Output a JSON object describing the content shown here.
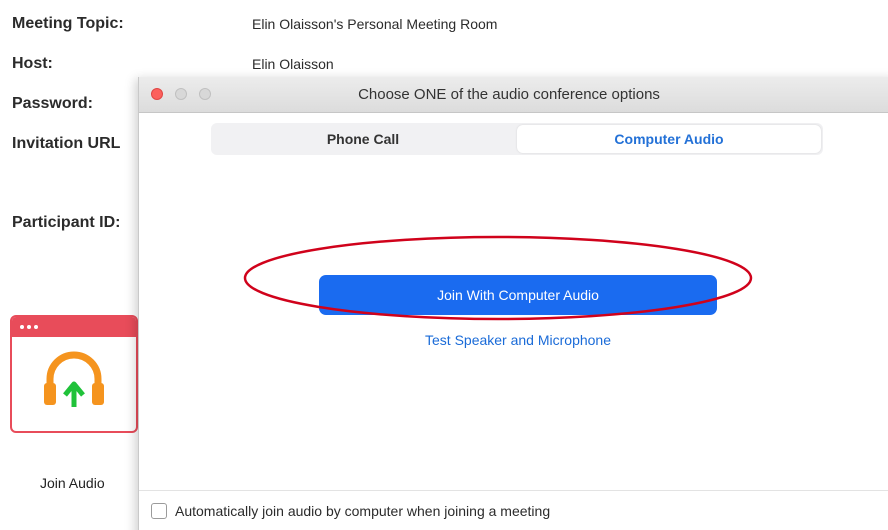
{
  "meeting_info": {
    "topic_label": "Meeting Topic:",
    "topic_value": "Elin Olaisson's Personal Meeting Room",
    "host_label": "Host:",
    "host_value": "Elin Olaisson",
    "password_label": "Password:",
    "invitation_label": "Invitation URL",
    "participant_label": "Participant ID:"
  },
  "join_audio_tile": {
    "caption": "Join Audio",
    "icon": "headphones-icon",
    "accent_color": "#e84c5a"
  },
  "dialog": {
    "title": "Choose ONE of the audio conference options",
    "tabs": [
      {
        "label": "Phone Call",
        "active": false
      },
      {
        "label": "Computer Audio",
        "active": true
      }
    ],
    "join_button_label": "Join With Computer Audio",
    "test_link_label": "Test Speaker and Microphone",
    "auto_join_label": "Automatically join audio by computer when joining a meeting",
    "auto_join_checked": false
  },
  "colors": {
    "primary_button": "#1a6bf0",
    "link": "#1a6bd8",
    "annotation": "#d0021b"
  }
}
